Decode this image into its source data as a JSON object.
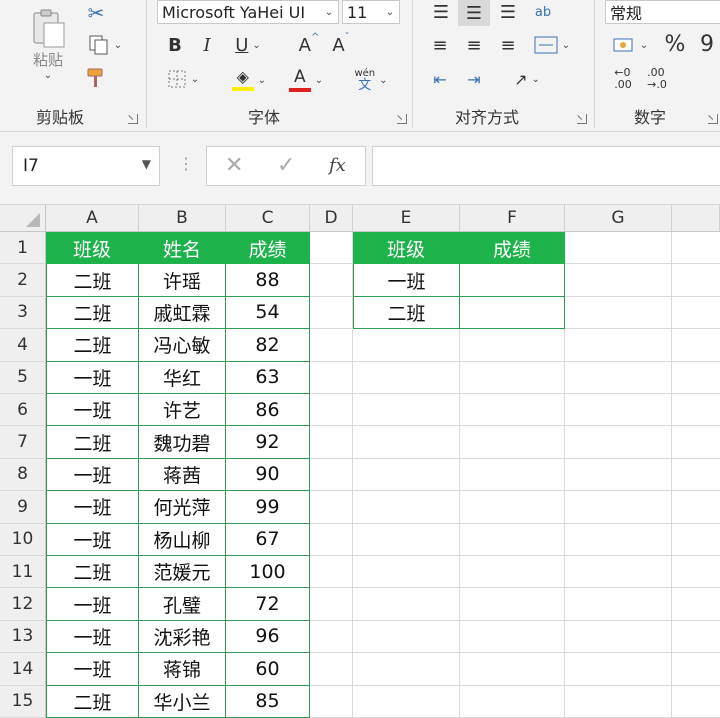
{
  "ribbon": {
    "clipboard": {
      "paste_label": "粘贴",
      "group_label": "剪贴板"
    },
    "font": {
      "font_name": "Microsoft YaHei UI",
      "font_size": "11",
      "bold": "B",
      "italic": "I",
      "underline": "U",
      "grow": "A",
      "shrink": "A",
      "font_color": "A",
      "phonetic_top": "wén",
      "phonetic_bottom": "文",
      "group_label": "字体"
    },
    "alignment": {
      "group_label": "对齐方式",
      "wrap_glyph": "ab"
    },
    "number": {
      "format": "常规",
      "percent": "%",
      "comma": "9",
      "inc_dec_a": "←0",
      "inc_dec_a2": ".00",
      "inc_dec_b": ".00",
      "inc_dec_b2": "→.0",
      "group_label": "数字"
    }
  },
  "formula_bar": {
    "name_box": "I7",
    "fx": "fx",
    "formula": ""
  },
  "columns": [
    "A",
    "B",
    "C",
    "D",
    "E",
    "F",
    "G",
    ""
  ],
  "rows": [
    "1",
    "2",
    "3",
    "4",
    "5",
    "6",
    "7",
    "8",
    "9",
    "10",
    "11",
    "12",
    "13",
    "14",
    "15"
  ],
  "table1": {
    "headers": [
      "班级",
      "姓名",
      "成绩"
    ],
    "rows": [
      [
        "二班",
        "许瑶",
        "88"
      ],
      [
        "二班",
        "戚虹霖",
        "54"
      ],
      [
        "二班",
        "冯心敏",
        "82"
      ],
      [
        "一班",
        "华红",
        "63"
      ],
      [
        "一班",
        "许艺",
        "86"
      ],
      [
        "二班",
        "魏功碧",
        "92"
      ],
      [
        "一班",
        "蒋茜",
        "90"
      ],
      [
        "一班",
        "何光萍",
        "99"
      ],
      [
        "一班",
        "杨山柳",
        "67"
      ],
      [
        "二班",
        "范媛元",
        "100"
      ],
      [
        "一班",
        "孔璧",
        "72"
      ],
      [
        "一班",
        "沈彩艳",
        "96"
      ],
      [
        "一班",
        "蒋锦",
        "60"
      ],
      [
        "二班",
        "华小兰",
        "85"
      ]
    ]
  },
  "table2": {
    "headers": [
      "班级",
      "成绩"
    ],
    "rows": [
      [
        "一班",
        ""
      ],
      [
        "二班",
        ""
      ]
    ]
  },
  "colors": {
    "header_fill": "#1db24a",
    "border": "#2e9a54"
  }
}
